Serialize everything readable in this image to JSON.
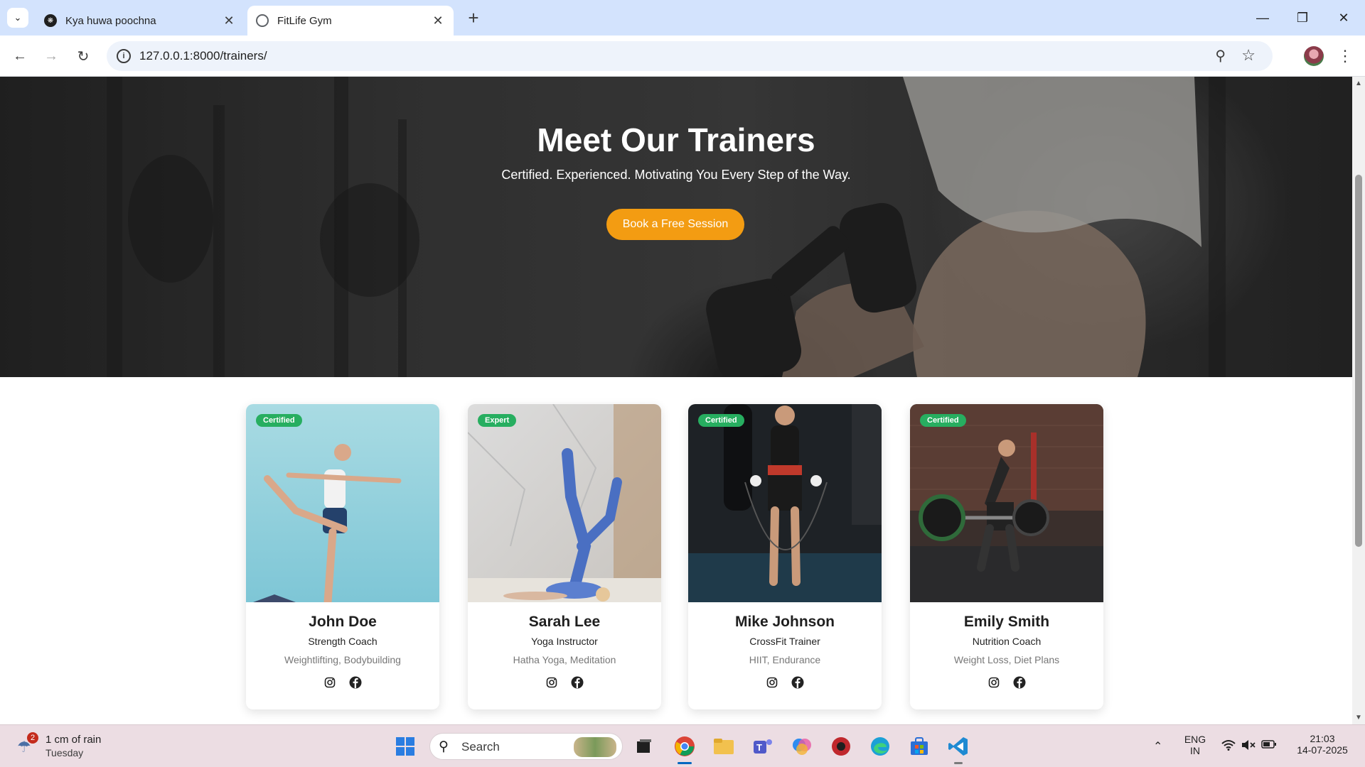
{
  "browser": {
    "tabs": [
      {
        "title": "Kya huwa poochna",
        "active": false,
        "icon": "chatgpt-icon"
      },
      {
        "title": "FitLife Gym",
        "active": true,
        "icon": "globe-icon"
      }
    ],
    "url": "127.0.0.1:8000/trainers/"
  },
  "hero": {
    "title": "Meet Our Trainers",
    "subtitle": "Certified. Experienced. Motivating You Every Step of the Way.",
    "cta_label": "Book a Free Session",
    "cta_color": "#f39c12"
  },
  "trainers": [
    {
      "badge": "Certified",
      "name": "John Doe",
      "role": "Strength Coach",
      "specialties": "Weightlifting, Bodybuilding"
    },
    {
      "badge": "Expert",
      "name": "Sarah Lee",
      "role": "Yoga Instructor",
      "specialties": "Hatha Yoga, Meditation"
    },
    {
      "badge": "Certified",
      "name": "Mike Johnson",
      "role": "CrossFit Trainer",
      "specialties": "HIIT, Endurance"
    },
    {
      "badge": "Certified",
      "name": "Emily Smith",
      "role": "Nutrition Coach",
      "specialties": "Weight Loss, Diet Plans"
    }
  ],
  "badge_color": "#27ae60",
  "taskbar": {
    "weather_badge": "2",
    "weather_line1": "1 cm of rain",
    "weather_line2": "Tuesday",
    "search_placeholder": "Search",
    "lang_line1": "ENG",
    "lang_line2": "IN",
    "time": "21:03",
    "date": "14-07-2025"
  }
}
